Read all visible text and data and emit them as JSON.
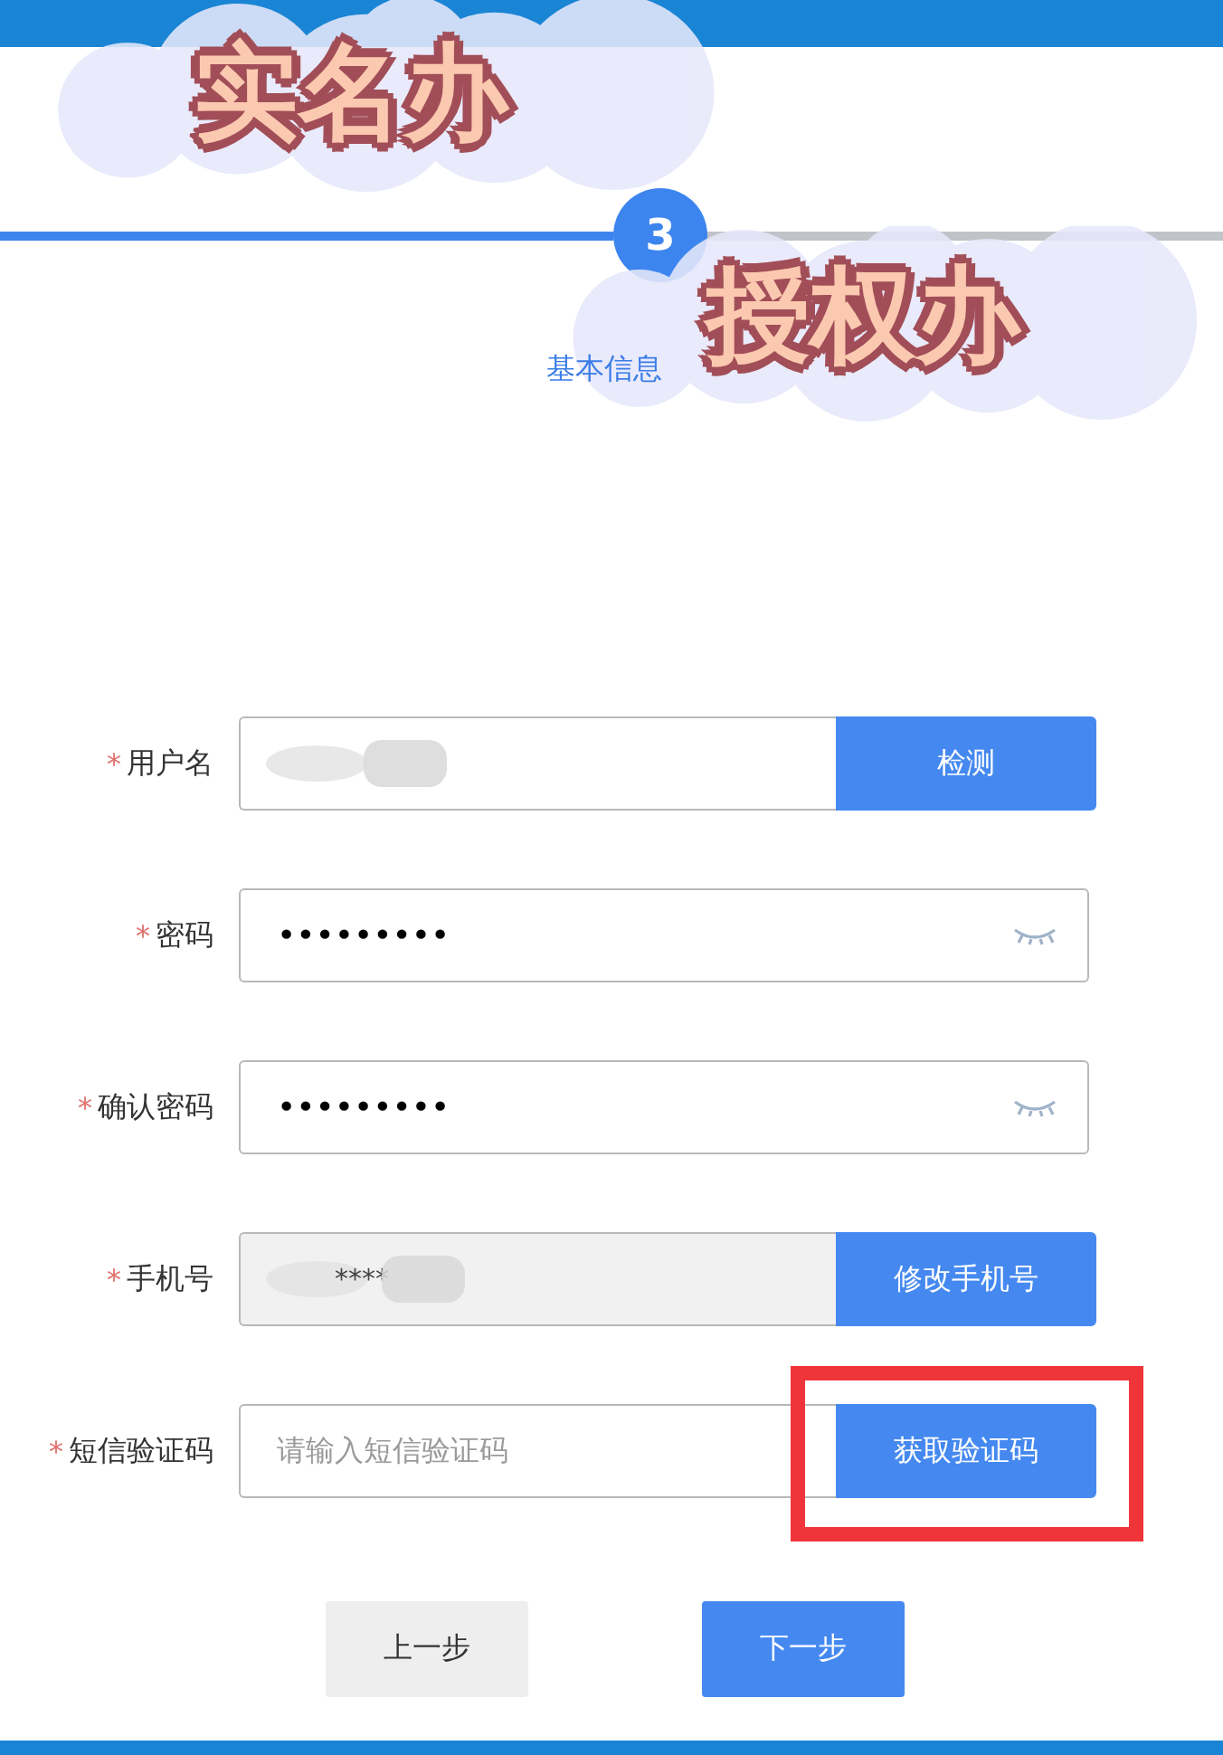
{
  "stepper": {
    "number": "3",
    "label": "基本信息"
  },
  "stickers": [
    {
      "text": "实名办"
    },
    {
      "text": "授权办"
    }
  ],
  "form": {
    "fields": [
      {
        "kind": "button-field",
        "required_mark": "*",
        "label": "用户名",
        "redacted": true,
        "button": "检测",
        "highlighted": false
      },
      {
        "kind": "password",
        "required_mark": "*",
        "label": "密码",
        "value": "•••••••••"
      },
      {
        "kind": "password",
        "required_mark": "*",
        "label": "确认密码",
        "value": "•••••••••"
      },
      {
        "kind": "button-field",
        "required_mark": "*",
        "label": "手机号",
        "value": "****",
        "redacted": true,
        "disabled": true,
        "button": "修改手机号",
        "highlighted": false
      },
      {
        "kind": "button-field",
        "required_mark": "*",
        "label": "短信验证码",
        "placeholder": "请输入短信验证码",
        "button": "获取验证码",
        "highlighted": true
      }
    ]
  },
  "buttons": [
    {
      "label": "上一步",
      "kind": "secondary"
    },
    {
      "label": "下一步",
      "kind": "primary"
    }
  ]
}
